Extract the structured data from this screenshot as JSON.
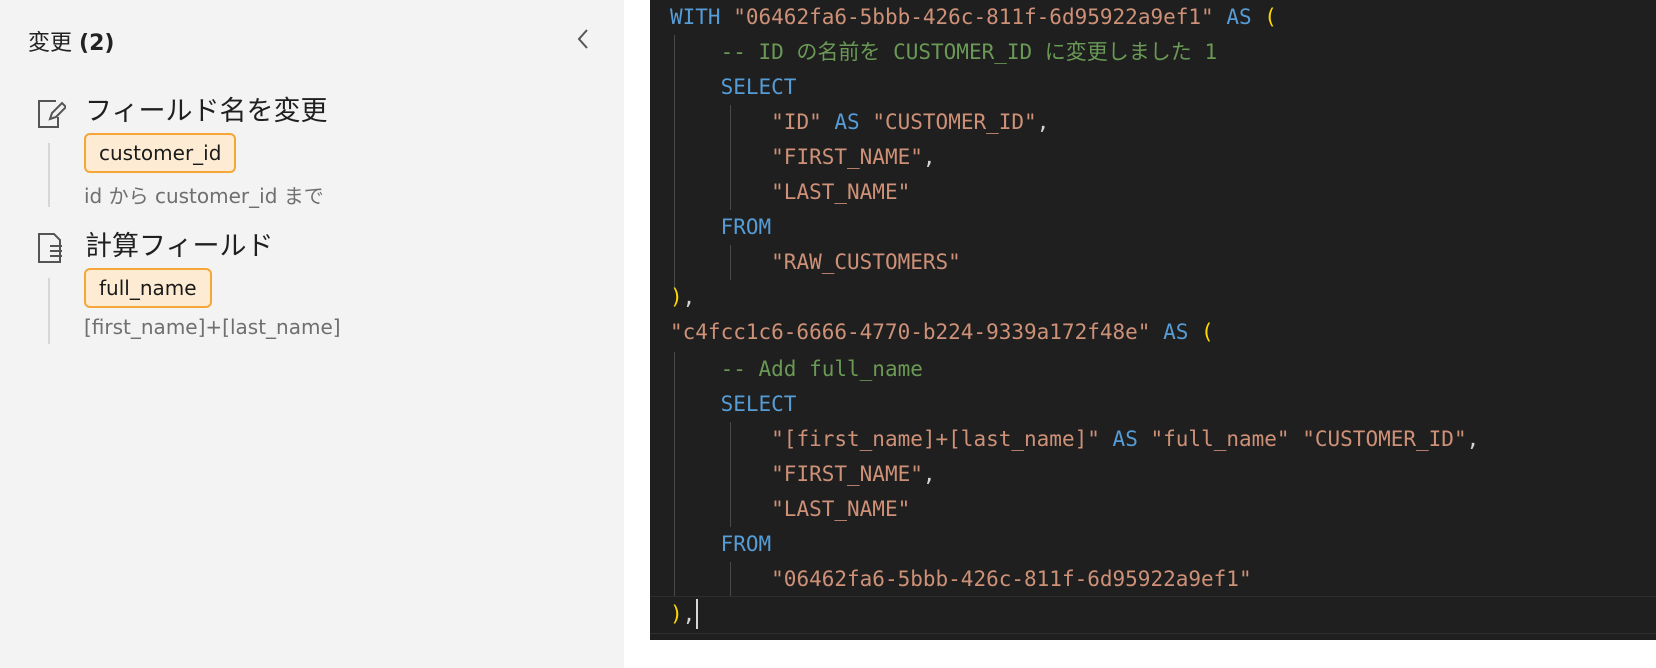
{
  "panel": {
    "title": "変更",
    "count": "(2)",
    "changes": [
      {
        "title": "フィールド名を変更",
        "icon": "rename-field-icon",
        "field": "customer_id",
        "description": "id から customer_id まで"
      },
      {
        "title": "計算フィールド",
        "icon": "calculated-field-icon",
        "field": "full_name",
        "description": "[first_name]+[last_name]"
      }
    ]
  },
  "code": {
    "l1": {
      "kw": "WITH",
      "name": "\"06462fa6-5bbb-426c-811f-6d95922a9ef1\"",
      "as": "AS",
      "paren": "("
    },
    "l2": "-- ID の名前を CUSTOMER_ID に変更しました 1",
    "l3": "SELECT",
    "l4": {
      "a": "\"ID\"",
      "as": "AS",
      "b": "\"CUSTOMER_ID\"",
      "comma": ","
    },
    "l5": {
      "a": "\"FIRST_NAME\"",
      "comma": ","
    },
    "l6": "\"LAST_NAME\"",
    "l7": "FROM",
    "l8": "\"RAW_CUSTOMERS\"",
    "l9": {
      "paren": ")",
      "comma": ","
    },
    "l10": {
      "name": "\"c4fcc1c6-6666-4770-b224-9339a172f48e\"",
      "as": "AS",
      "paren": "("
    },
    "l11": "-- Add full_name",
    "l12": "SELECT",
    "l13": {
      "a": "\"[first_name]+[last_name]\"",
      "as": "AS",
      "b": "\"full_name\"",
      "c": "\"CUSTOMER_ID\"",
      "comma": ","
    },
    "l14": {
      "a": "\"FIRST_NAME\"",
      "comma": ","
    },
    "l15": "\"LAST_NAME\"",
    "l16": "FROM",
    "l17": "\"06462fa6-5bbb-426c-811f-6d95922a9ef1\"",
    "l18": {
      "paren": ")",
      "comma": ","
    }
  },
  "colors": {
    "keyword": "#569cd6",
    "string": "#ce9178",
    "comment": "#6a9955",
    "bracket": "#ffd700",
    "chip_border": "#f5a636",
    "chip_bg": "#fdecd3"
  }
}
